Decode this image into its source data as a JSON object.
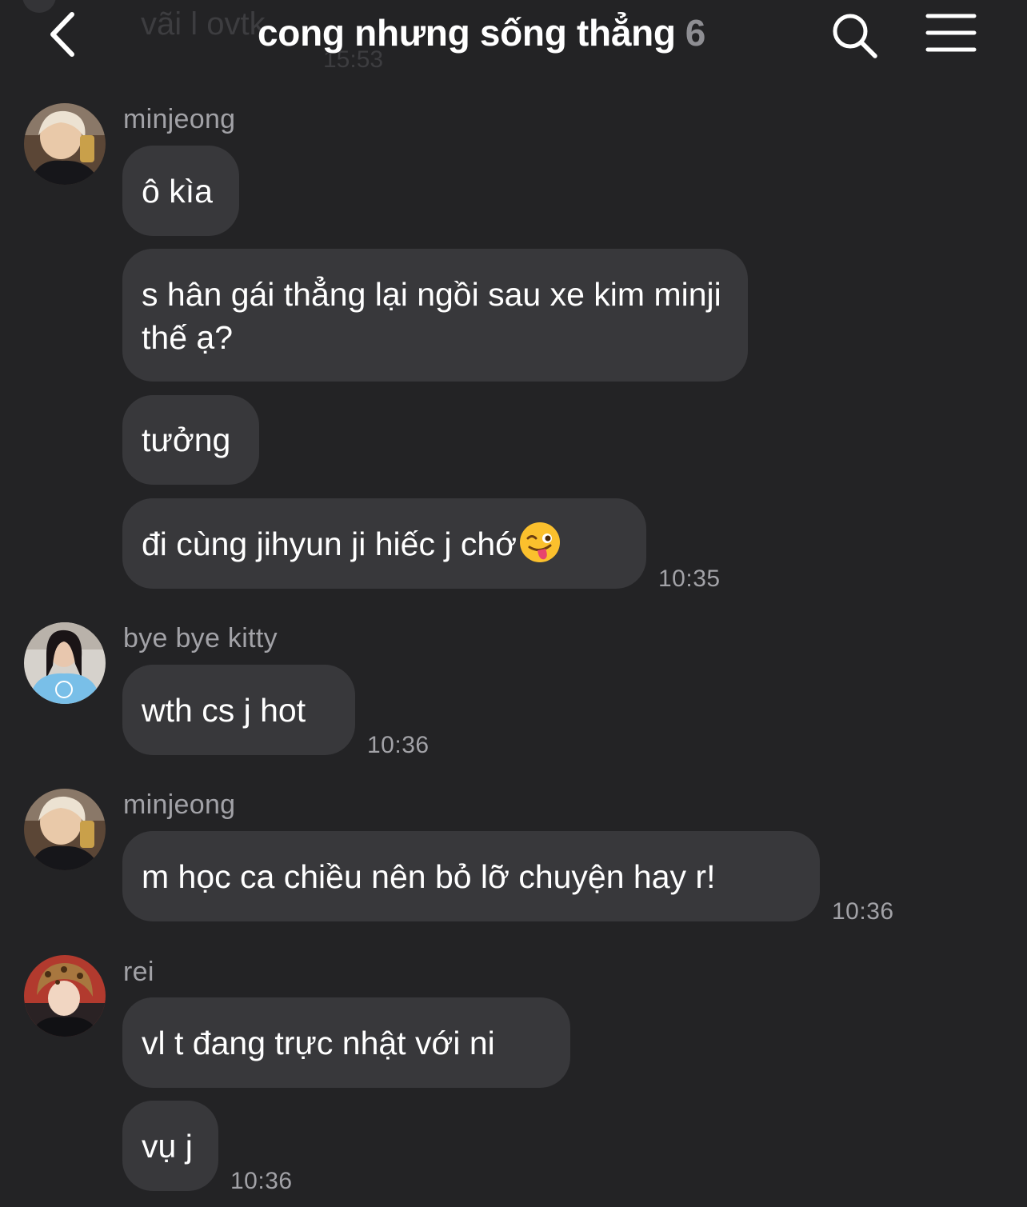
{
  "header": {
    "background_preview_name": "vãi l ovtk",
    "background_preview_time": "15:53",
    "title": "cong nhưng sống thẳng",
    "member_count": "6",
    "back_icon": "chevron-left-icon",
    "search_icon": "search-icon",
    "menu_icon": "hamburger-menu-icon"
  },
  "messages": [
    {
      "sender": "minjeong",
      "bubbles": [
        "ô kìa",
        "s hân gái thẳng lại ngồi sau xe kim minji thế ạ?",
        "tưởng",
        "đi cùng jihyun ji hiếc j chớ"
      ],
      "emoji": "winking-face-with-tongue",
      "time": "10:35"
    },
    {
      "sender": "bye bye kitty",
      "bubbles": [
        "wth cs j hot"
      ],
      "time": "10:36"
    },
    {
      "sender": "minjeong",
      "bubbles": [
        "m học ca chiều nên bỏ lỡ chuyện hay r!"
      ],
      "time": "10:36"
    },
    {
      "sender": "rei",
      "bubbles": [
        "vl t đang trực nhật với ni",
        "vụ j"
      ],
      "time": "10:36"
    }
  ],
  "colors": {
    "background": "#232325",
    "bubble": "#38383b",
    "secondary_text": "#a2a2a7",
    "primary_text": "#ffffff"
  }
}
